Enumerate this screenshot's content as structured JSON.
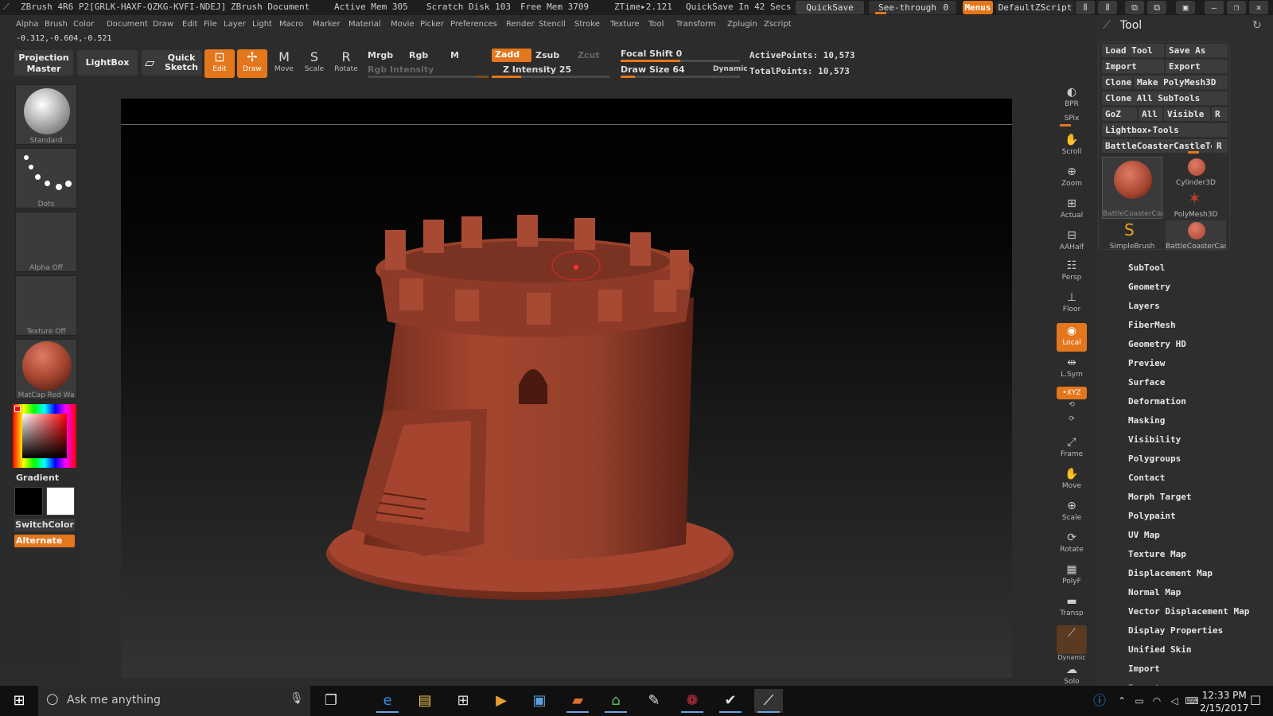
{
  "titlebar": {
    "app": "ZBrush 4R6 P2[GRLK-HAXF-QZKG-KVFI-NDEJ]",
    "document": "ZBrush Document",
    "active_mem": "Active Mem 305",
    "scratch_disk": "Scratch Disk 103",
    "free_mem": "Free Mem 3709",
    "ztime": "ZTime▸2.121",
    "quicksave_in": "QuickSave In 42 Secs",
    "quicksave_btn": "QuickSave",
    "see_through": "See-through",
    "see_through_value": "0",
    "menus_btn": "Menus",
    "default_zscript": "DefaultZScript"
  },
  "menu": [
    "Alpha",
    "Brush",
    "Color",
    "Document",
    "Draw",
    "Edit",
    "File",
    "Layer",
    "Light",
    "Macro",
    "Marker",
    "Material",
    "Movie",
    "Picker",
    "Preferences",
    "Render",
    "Stencil",
    "Stroke",
    "Texture",
    "Tool",
    "Transform",
    "Zplugin",
    "Zscript"
  ],
  "coords": "-0.312,-0.604,-0.521",
  "toolbar": {
    "projection_master": "Projection Master",
    "lightbox": "LightBox",
    "quick_sketch": "Quick Sketch",
    "edit": "Edit",
    "draw": "Draw",
    "move": "Move",
    "scale": "Scale",
    "rotate": "Rotate",
    "mrgb": "Mrgb",
    "rgb": "Rgb",
    "m": "M",
    "zadd": "Zadd",
    "zsub": "Zsub",
    "zcut": "Zcut",
    "rgb_intensity": "Rgb Intensity",
    "z_intensity": "Z Intensity 25",
    "focal_shift": "Focal Shift 0",
    "draw_size": "Draw Size 64",
    "dynamic": "Dynamic",
    "active_points": "ActivePoints: 10,573",
    "total_points": "TotalPoints: 10,573",
    "z_intensity_level": 0.25,
    "draw_size_level": 0.12,
    "focal_shift_level": 0.5
  },
  "left_shelf": {
    "brush": "Standard",
    "stroke": "Dots",
    "alpha": "Alpha  Off",
    "texture": "Texture  Off",
    "material": "MatCap Red Wa",
    "gradient": "Gradient",
    "switch_color": "SwitchColor",
    "alternate": "Alternate"
  },
  "right_shelf": [
    {
      "name": "bpr",
      "label": "BPR"
    },
    {
      "name": "spix",
      "label": "SPix"
    },
    {
      "name": "scroll",
      "label": "Scroll"
    },
    {
      "name": "zoom",
      "label": "Zoom"
    },
    {
      "name": "actual",
      "label": "Actual"
    },
    {
      "name": "aahalf",
      "label": "AAHalf"
    },
    {
      "name": "persp",
      "label": "Persp"
    },
    {
      "name": "floor",
      "label": "Floor"
    },
    {
      "name": "local",
      "label": "Local"
    },
    {
      "name": "lsym",
      "label": "L.Sym"
    },
    {
      "name": "xyz",
      "label": "•XYZ"
    },
    {
      "name": "frame",
      "label": "Frame"
    },
    {
      "name": "move",
      "label": "Move"
    },
    {
      "name": "scale",
      "label": "Scale"
    },
    {
      "name": "rotate",
      "label": "Rotate"
    },
    {
      "name": "polyf",
      "label": "PolyF"
    },
    {
      "name": "transp",
      "label": "Transp"
    },
    {
      "name": "dynamic",
      "label": "Dynamic"
    },
    {
      "name": "solo",
      "label": "Solo"
    }
  ],
  "tool_panel": {
    "title": "Tool",
    "load_tool": "Load Tool",
    "save_as": "Save As",
    "import": "Import",
    "export": "Export",
    "clone": "Clone",
    "make_polymesh": "Make PolyMesh3D",
    "clone_all": "Clone All SubTools",
    "goz": "GoZ",
    "all": "All",
    "visible": "Visible",
    "r": "R",
    "lightbox_tools": "Lightbox▸Tools",
    "current_tool": "BattleCoasterCastleTov",
    "thumbs": [
      "BattleCoasterCas",
      "Cylinder3D",
      "PolyMesh3D",
      "SimpleBrush",
      "BattleCoasterCas"
    ],
    "sections": [
      "SubTool",
      "Geometry",
      "Layers",
      "FiberMesh",
      "Geometry HD",
      "Preview",
      "Surface",
      "Deformation",
      "Masking",
      "Visibility",
      "Polygroups",
      "Contact",
      "Morph Target",
      "Polypaint",
      "UV Map",
      "Texture Map",
      "Displacement Map",
      "Normal Map",
      "Vector Displacement Map",
      "Display Properties",
      "Unified Skin",
      "Import",
      "Export"
    ]
  },
  "taskbar": {
    "search_placeholder": "Ask me anything",
    "time": "12:33 PM",
    "date": "2/15/2017"
  },
  "colors": {
    "accent": "#e4761b",
    "model": "#a5452f"
  }
}
